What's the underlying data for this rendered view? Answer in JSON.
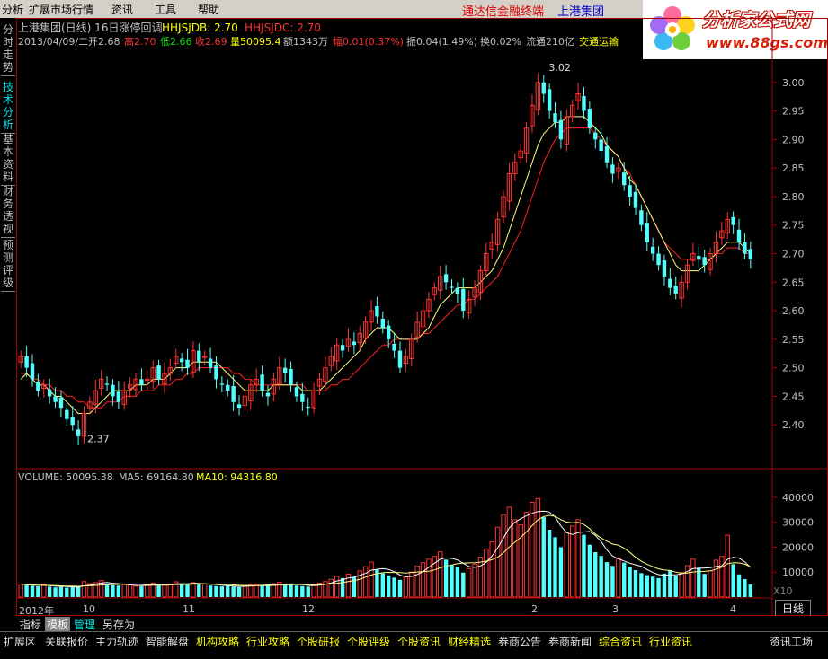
{
  "menu": {
    "items": [
      "分析",
      "扩展市场行情",
      "资讯",
      "工具",
      "帮助"
    ]
  },
  "promo": {
    "broker": "通达信金融终端",
    "stock": "上港集团"
  },
  "logo": {
    "text": "分析家公式网",
    "url": "www.88gs.com"
  },
  "left_tabs": [
    {
      "label": "分时走势"
    },
    {
      "label": "技术分析"
    },
    {
      "label": "基本资料"
    },
    {
      "label": "财务透视"
    },
    {
      "label": "预测评级"
    }
  ],
  "header": {
    "line1": {
      "title": "上港集团(日线) 16日涨停回调",
      "ind1": "HHJSJDB: 2.70",
      "ind2": "HHJSJDC: 2.70"
    },
    "line2": {
      "date": "2013/04/09/二",
      "open": "开2.68",
      "high": "高2.70",
      "low": "低2.66",
      "close": "收2.69",
      "volume": "量50095.4",
      "amount": "额1343万",
      "change": "幅0.01(0.37%)",
      "amplitude": "振0.04(1.49%)",
      "turnover": "换0.02%",
      "float": "流通210亿",
      "sector": "交通运输"
    }
  },
  "price_axis": {
    "ticks": [
      "3.00",
      "2.95",
      "2.90",
      "2.85",
      "2.80",
      "2.75",
      "2.70",
      "2.65",
      "2.60",
      "2.55",
      "2.50",
      "2.45",
      "2.40"
    ]
  },
  "annotations": {
    "high_label": "3.02",
    "low_label": "2.37"
  },
  "volume_header": {
    "vol": "VOLUME: 50095.38",
    "ma5": "MA5: 69164.80",
    "ma10": "MA10: 94316.80"
  },
  "volume_axis": {
    "ticks": [
      "40000",
      "30000",
      "20000",
      "10000"
    ],
    "unit": "X10"
  },
  "date_axis": {
    "labels": [
      "2012年",
      "10",
      "11",
      "12",
      "2",
      "3",
      "4"
    ]
  },
  "period": {
    "label": "日线",
    "plus": "+",
    "minus": "-"
  },
  "panel_tabs": [
    "指标",
    "模板",
    "管理",
    "另存为"
  ],
  "footer_tabs": [
    "扩展区",
    "关联报价",
    "主力轨迹",
    "智能解盘",
    "机构攻略",
    "行业攻略",
    "个股研报",
    "个股评级",
    "个股资讯",
    "财经精选",
    "券商公告",
    "券商新闻",
    "综合资讯",
    "行业资讯",
    "资讯工场"
  ],
  "colors": {
    "up": "#ff3232",
    "down": "#54ffff",
    "ma_fast": "#ffff80",
    "ma_slow": "#ff2020",
    "text_red": "#ff3232",
    "text_green": "#00e000",
    "text_yellow": "#ffff00"
  },
  "chart_data": {
    "type": "candlestick",
    "ylim": [
      2.35,
      3.05
    ],
    "closes": [
      2.52,
      2.5,
      2.48,
      2.46,
      2.47,
      2.45,
      2.44,
      2.43,
      2.41,
      2.4,
      2.38,
      2.42,
      2.44,
      2.46,
      2.48,
      2.47,
      2.45,
      2.44,
      2.46,
      2.47,
      2.48,
      2.47,
      2.48,
      2.5,
      2.48,
      2.49,
      2.5,
      2.52,
      2.51,
      2.5,
      2.53,
      2.51,
      2.52,
      2.5,
      2.48,
      2.47,
      2.46,
      2.44,
      2.43,
      2.45,
      2.47,
      2.48,
      2.46,
      2.45,
      2.48,
      2.5,
      2.49,
      2.47,
      2.45,
      2.44,
      2.43,
      2.46,
      2.48,
      2.5,
      2.52,
      2.54,
      2.53,
      2.55,
      2.54,
      2.56,
      2.58,
      2.6,
      2.59,
      2.57,
      2.55,
      2.53,
      2.5,
      2.52,
      2.55,
      2.58,
      2.6,
      2.62,
      2.64,
      2.66,
      2.65,
      2.64,
      2.63,
      2.6,
      2.62,
      2.64,
      2.67,
      2.7,
      2.72,
      2.76,
      2.8,
      2.84,
      2.86,
      2.88,
      2.92,
      2.96,
      3.0,
      2.98,
      2.95,
      2.93,
      2.9,
      2.94,
      2.96,
      2.98,
      2.95,
      2.92,
      2.9,
      2.88,
      2.86,
      2.84,
      2.85,
      2.82,
      2.8,
      2.78,
      2.75,
      2.72,
      2.7,
      2.68,
      2.66,
      2.64,
      2.63,
      2.65,
      2.68,
      2.7,
      2.69,
      2.68,
      2.7,
      2.72,
      2.74,
      2.76,
      2.75,
      2.72,
      2.7,
      2.69
    ],
    "volumes": [
      5200,
      4800,
      4500,
      4300,
      5100,
      4200,
      3900,
      4100,
      3800,
      4400,
      4000,
      6200,
      5400,
      5800,
      6600,
      5200,
      4700,
      4600,
      5000,
      4800,
      4400,
      4300,
      4900,
      5600,
      4700,
      5000,
      5200,
      6100,
      5500,
      4900,
      5800,
      5100,
      5300,
      4600,
      4400,
      4300,
      4500,
      4200,
      4000,
      4600,
      5000,
      5200,
      4800,
      4700,
      5400,
      5900,
      5300,
      4900,
      4600,
      4400,
      4200,
      5000,
      5600,
      6200,
      7100,
      8300,
      7600,
      9200,
      8000,
      10500,
      12200,
      14000,
      11000,
      9500,
      8700,
      7800,
      6900,
      8000,
      10000,
      12500,
      13800,
      15200,
      16300,
      18100,
      15000,
      13000,
      12000,
      9800,
      11400,
      13200,
      16000,
      19300,
      22100,
      28000,
      33000,
      36000,
      31000,
      29000,
      34000,
      38000,
      39500,
      32000,
      27000,
      24000,
      20000,
      26000,
      28500,
      31000,
      25000,
      21000,
      18000,
      16500,
      14000,
      12500,
      15600,
      13800,
      12000,
      10800,
      9600,
      8800,
      8200,
      7600,
      9400,
      10800,
      8600,
      9800,
      12600,
      15200,
      11500,
      9300,
      10500,
      14800,
      16300,
      24800,
      13200,
      9100,
      7200,
      5009
    ],
    "ma_fast": [
      2.48,
      2.49,
      2.48,
      2.47,
      2.47,
      2.46,
      2.45,
      2.45,
      2.44,
      2.43,
      2.42,
      2.42,
      2.42,
      2.43,
      2.44,
      2.45,
      2.46,
      2.46,
      2.46,
      2.46,
      2.47,
      2.47,
      2.47,
      2.48,
      2.48,
      2.48,
      2.49,
      2.5,
      2.5,
      2.5,
      2.51,
      2.51,
      2.51,
      2.51,
      2.51,
      2.5,
      2.49,
      2.48,
      2.47,
      2.46,
      2.46,
      2.46,
      2.46,
      2.46,
      2.47,
      2.47,
      2.47,
      2.47,
      2.47,
      2.46,
      2.46,
      2.46,
      2.46,
      2.47,
      2.48,
      2.49,
      2.5,
      2.51,
      2.52,
      2.53,
      2.55,
      2.56,
      2.57,
      2.57,
      2.57,
      2.56,
      2.55,
      2.55,
      2.55,
      2.55,
      2.56,
      2.57,
      2.59,
      2.61,
      2.62,
      2.63,
      2.64,
      2.64,
      2.64,
      2.64,
      2.65,
      2.66,
      2.67,
      2.69,
      2.71,
      2.74,
      2.77,
      2.8,
      2.83,
      2.86,
      2.89,
      2.91,
      2.92,
      2.93,
      2.93,
      2.94,
      2.94,
      2.94,
      2.94,
      2.93,
      2.92,
      2.91,
      2.89,
      2.88,
      2.87,
      2.85,
      2.83,
      2.82,
      2.8,
      2.78,
      2.76,
      2.74,
      2.72,
      2.7,
      2.68,
      2.67,
      2.67,
      2.67,
      2.67,
      2.68,
      2.69,
      2.7,
      2.71,
      2.72,
      2.72,
      2.72,
      2.71,
      2.7
    ],
    "ma_slow": [
      2.49,
      2.49,
      2.48,
      2.48,
      2.47,
      2.47,
      2.46,
      2.46,
      2.45,
      2.45,
      2.44,
      2.44,
      2.43,
      2.43,
      2.43,
      2.44,
      2.44,
      2.44,
      2.45,
      2.45,
      2.45,
      2.46,
      2.46,
      2.46,
      2.47,
      2.47,
      2.47,
      2.48,
      2.48,
      2.49,
      2.49,
      2.5,
      2.5,
      2.5,
      2.5,
      2.5,
      2.5,
      2.49,
      2.49,
      2.48,
      2.48,
      2.47,
      2.47,
      2.47,
      2.47,
      2.47,
      2.47,
      2.47,
      2.47,
      2.47,
      2.46,
      2.46,
      2.46,
      2.46,
      2.47,
      2.47,
      2.48,
      2.48,
      2.49,
      2.5,
      2.51,
      2.52,
      2.53,
      2.54,
      2.54,
      2.55,
      2.55,
      2.55,
      2.55,
      2.55,
      2.56,
      2.56,
      2.57,
      2.58,
      2.59,
      2.6,
      2.61,
      2.61,
      2.62,
      2.62,
      2.63,
      2.64,
      2.65,
      2.66,
      2.68,
      2.7,
      2.72,
      2.74,
      2.77,
      2.8,
      2.83,
      2.86,
      2.88,
      2.9,
      2.91,
      2.92,
      2.92,
      2.92,
      2.92,
      2.92,
      2.91,
      2.9,
      2.89,
      2.88,
      2.87,
      2.85,
      2.84,
      2.82,
      2.8,
      2.78,
      2.76,
      2.74,
      2.72,
      2.71,
      2.7,
      2.69,
      2.69,
      2.69,
      2.69,
      2.69,
      2.69,
      2.7,
      2.7,
      2.71,
      2.71,
      2.71,
      2.7,
      2.7
    ]
  }
}
